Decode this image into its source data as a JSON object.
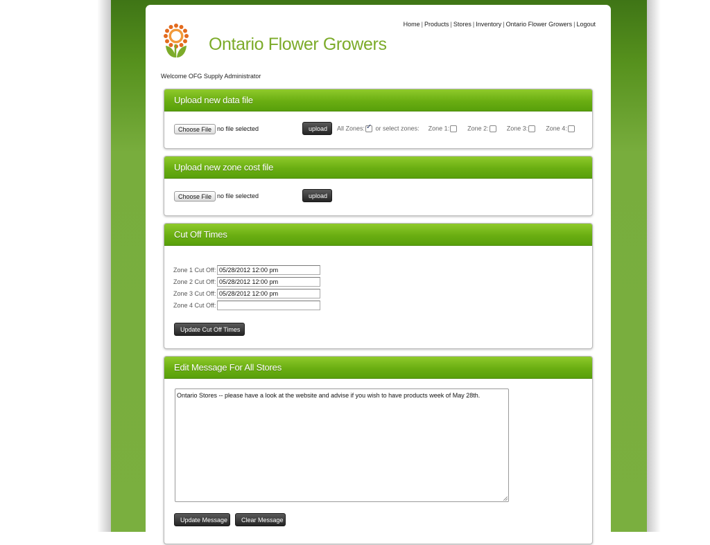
{
  "site": {
    "name": "Ontario Flower Growers",
    "welcome": "Welcome OFG Supply Administrator"
  },
  "nav": [
    {
      "label": "Home"
    },
    {
      "label": "Products"
    },
    {
      "label": "Stores"
    },
    {
      "label": "Inventory"
    },
    {
      "label": "Ontario Flower Growers"
    },
    {
      "label": "Logout"
    }
  ],
  "upload_data": {
    "title": "Upload new data file",
    "choose_label": "Choose File",
    "file_status": "no file selected",
    "upload_label": "upload",
    "all_zones_label": "All Zones:",
    "all_zones_checked": true,
    "or_select_label": "or select zones:",
    "zones": [
      {
        "label": "Zone 1:",
        "checked": false
      },
      {
        "label": "Zone 2:",
        "checked": false
      },
      {
        "label": "Zone 3:",
        "checked": false
      },
      {
        "label": "Zone 4:",
        "checked": false
      }
    ]
  },
  "upload_zone_cost": {
    "title": "Upload new zone cost file",
    "choose_label": "Choose File",
    "file_status": "no file selected",
    "upload_label": "upload"
  },
  "cutoff": {
    "title": "Cut Off Times",
    "rows": [
      {
        "label": "Zone 1 Cut Off:",
        "value": "05/28/2012 12:00 pm"
      },
      {
        "label": "Zone 2 Cut Off:",
        "value": "05/28/2012 12:00 pm"
      },
      {
        "label": "Zone 3 Cut Off:",
        "value": "05/28/2012 12:00 pm"
      },
      {
        "label": "Zone 4 Cut Off:",
        "value": ""
      }
    ],
    "update_label": "Update Cut Off Times"
  },
  "message": {
    "title": "Edit Message For All Stores",
    "text": "Ontario Stores -- please have a look at the website and advise if you wish to have products week of May 28th.",
    "update_label": "Update Message",
    "clear_label": "Clear Message"
  },
  "colors": {
    "brand_green": "#7cab2a",
    "header_green": "#6aae12",
    "logo_orange": "#e36b1e"
  }
}
